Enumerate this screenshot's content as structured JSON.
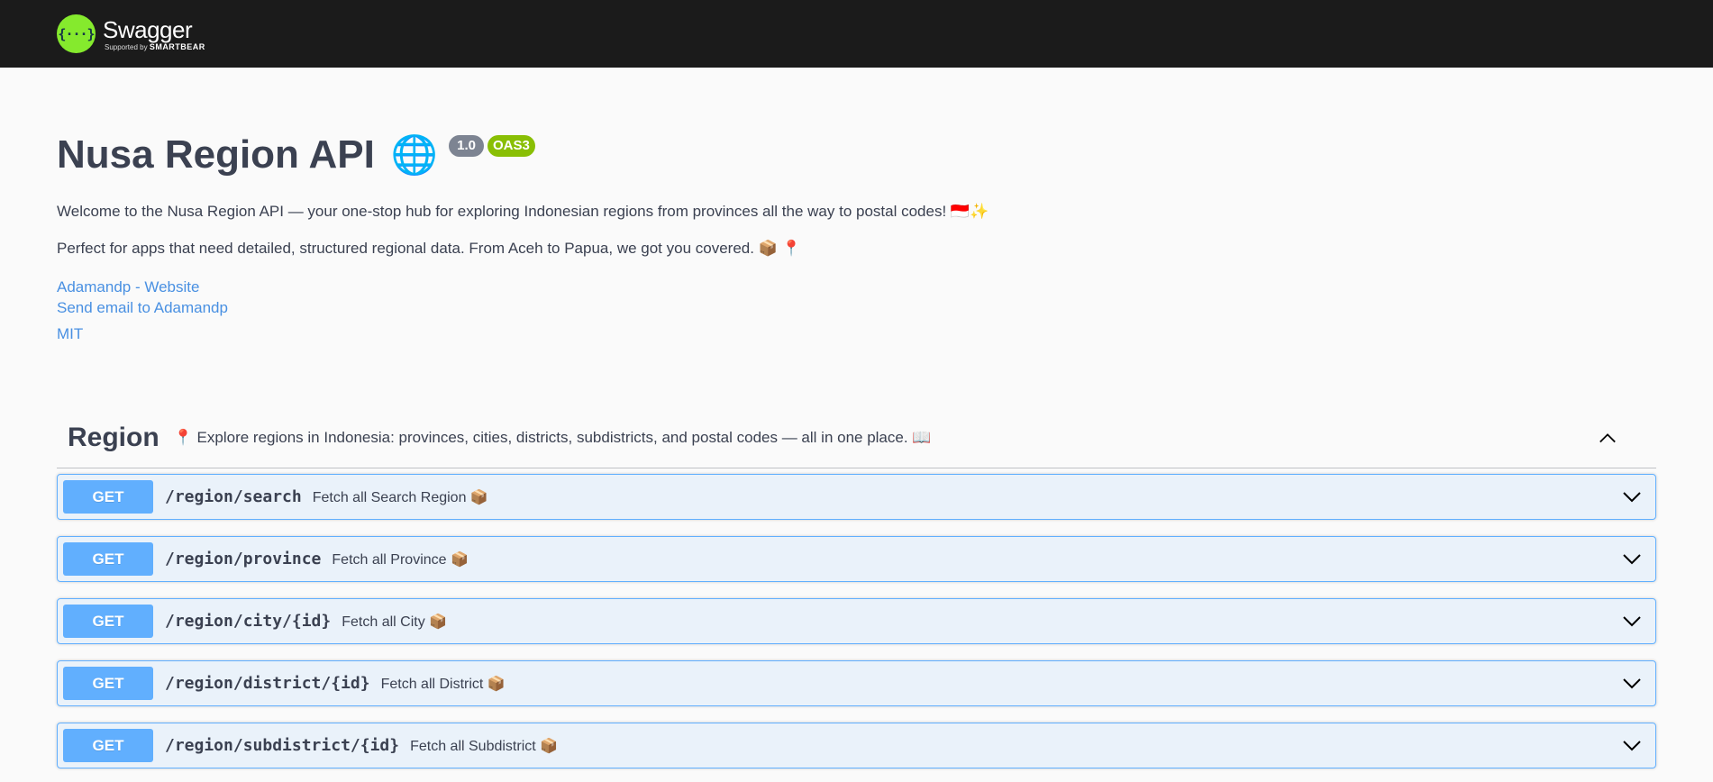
{
  "topbar": {
    "logo_glyph": "{···}",
    "brand": "Swagger",
    "supported_prefix": "Supported by ",
    "supported_brand": "SMARTBEAR"
  },
  "info": {
    "title": "Nusa Region API",
    "title_emoji": "🌐",
    "version": "1.0",
    "oas": "OAS3",
    "description_1": "Welcome to the Nusa Region API — your one-stop hub for exploring Indonesian regions from provinces all the way to postal codes! 🇮🇩✨",
    "description_2": "Perfect for apps that need detailed, structured regional data. From Aceh to Papua, we got you covered. 📦 📍",
    "link_website": "Adamandp - Website",
    "link_email": "Send email to Adamandp",
    "license": "MIT"
  },
  "tag": {
    "name": "Region",
    "description": "📍 Explore regions in Indonesia: provinces, cities, districts, subdistricts, and postal codes — all in one place. 📖"
  },
  "operations": [
    {
      "method": "GET",
      "path": "/region/search",
      "summary": "Fetch all Search Region 📦"
    },
    {
      "method": "GET",
      "path": "/region/province",
      "summary": "Fetch all Province 📦"
    },
    {
      "method": "GET",
      "path": "/region/city/{id}",
      "summary": "Fetch all City 📦"
    },
    {
      "method": "GET",
      "path": "/region/district/{id}",
      "summary": "Fetch all District 📦"
    },
    {
      "method": "GET",
      "path": "/region/subdistrict/{id}",
      "summary": "Fetch all Subdistrict 📦"
    }
  ],
  "colors": {
    "topbar": "#1b1b1b",
    "logo": "#85ea2d",
    "get": "#61affe",
    "version_badge": "#7d8492",
    "oas_badge": "#89bf04",
    "link": "#4990e2"
  }
}
